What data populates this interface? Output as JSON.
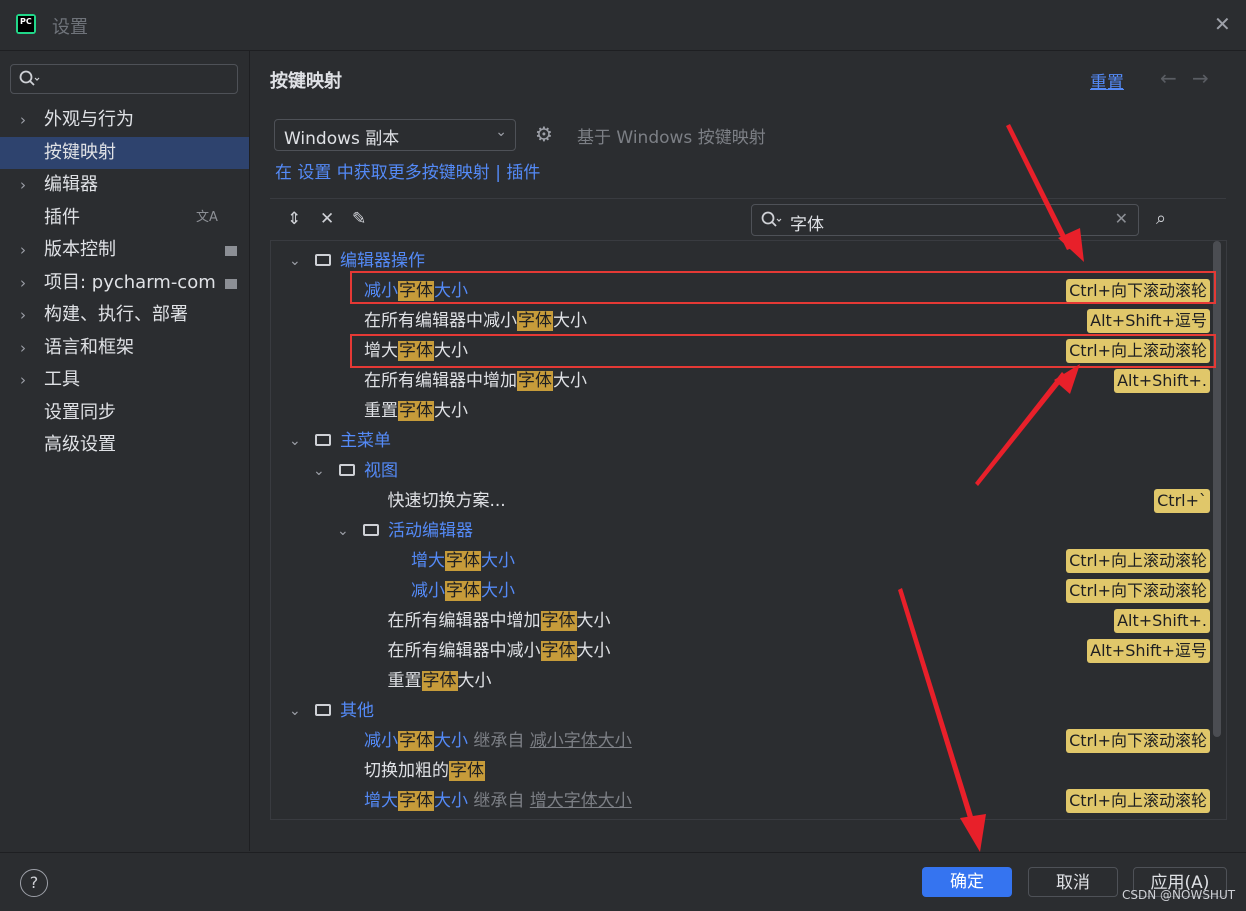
{
  "window": {
    "title": "设置",
    "logo_text": "PC"
  },
  "sidebar": {
    "items": [
      {
        "label": "外观与行为",
        "chevron": true
      },
      {
        "label": "按键映射",
        "selected": true
      },
      {
        "label": "编辑器",
        "chevron": true
      },
      {
        "label": "插件",
        "right_icon": "translate-icon"
      },
      {
        "label": "版本控制",
        "chevron": true,
        "right_icon": "square-icon"
      },
      {
        "label": "项目: pycharm-com",
        "chevron": true,
        "right_icon": "square-icon"
      },
      {
        "label": "构建、执行、部署",
        "chevron": true
      },
      {
        "label": "语言和框架",
        "chevron": true
      },
      {
        "label": "工具",
        "chevron": true
      },
      {
        "label": "设置同步"
      },
      {
        "label": "高级设置"
      }
    ]
  },
  "main": {
    "heading": "按键映射",
    "reset": "重置",
    "scheme": "Windows 副本",
    "based_on": "基于 Windows 按键映射",
    "get_more": "在 设置 中获取更多按键映射 | 插件",
    "search_value": "字体"
  },
  "tree": [
    {
      "type": "folder",
      "label": "编辑器操作",
      "blue": true
    },
    {
      "pre": "减小",
      "mark": "字体",
      "post": "大小",
      "blue": true,
      "shortcut": "Ctrl+向下滚动滚轮"
    },
    {
      "pre": "在所有编辑器中减小",
      "mark": "字体",
      "post": "大小",
      "shortcut": "Alt+Shift+逗号"
    },
    {
      "pre": "增大",
      "mark": "字体",
      "post": "大小",
      "shortcut": "Ctrl+向上滚动滚轮"
    },
    {
      "pre": "在所有编辑器中增加",
      "mark": "字体",
      "post": "大小",
      "shortcut": "Alt+Shift+."
    },
    {
      "pre": "重置",
      "mark": "字体",
      "post": "大小"
    },
    {
      "type": "folder",
      "label": "主菜单",
      "blue": true
    },
    {
      "type": "folder",
      "label": "视图",
      "blue": true
    },
    {
      "pre": "快速切换方案...",
      "mark": "",
      "post": "",
      "shortcut": "Ctrl+`"
    },
    {
      "type": "folder",
      "label": "活动编辑器",
      "blue": true
    },
    {
      "pre": "增大",
      "mark": "字体",
      "post": "大小",
      "blue": true,
      "shortcut": "Ctrl+向上滚动滚轮"
    },
    {
      "pre": "减小",
      "mark": "字体",
      "post": "大小",
      "blue": true,
      "shortcut": "Ctrl+向下滚动滚轮"
    },
    {
      "pre": "在所有编辑器中增加",
      "mark": "字体",
      "post": "大小",
      "shortcut": "Alt+Shift+."
    },
    {
      "pre": "在所有编辑器中减小",
      "mark": "字体",
      "post": "大小",
      "shortcut": "Alt+Shift+逗号"
    },
    {
      "pre": "重置",
      "mark": "字体",
      "post": "大小"
    },
    {
      "type": "folder",
      "label": "其他",
      "blue": true
    },
    {
      "pre": "减小",
      "mark": "字体",
      "post": "大小",
      "blue": true,
      "inherit": "继承自",
      "inherit_link": "减小字体大小",
      "shortcut": "Ctrl+向下滚动滚轮"
    },
    {
      "pre": "切换加粗的",
      "mark": "字体",
      "post": ""
    },
    {
      "pre": "增大",
      "mark": "字体",
      "post": "大小",
      "blue": true,
      "inherit": "继承自",
      "inherit_link": "增大字体大小",
      "shortcut": "Ctrl+向上滚动滚轮"
    }
  ],
  "footer": {
    "ok": "确定",
    "cancel": "取消",
    "apply": "应用(A)",
    "help": "?"
  },
  "watermark": "CSDN @NOWSHUT"
}
